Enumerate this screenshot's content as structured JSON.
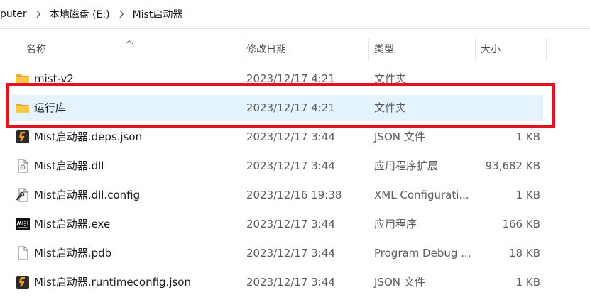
{
  "breadcrumb": [
    "puter",
    "本地磁盘 (E:)",
    "Mist启动器"
  ],
  "columns": {
    "name": "名称",
    "date": "修改日期",
    "type": "类型",
    "size": "大小"
  },
  "files": [
    {
      "name": "mist-v2",
      "date": "2023/12/17 4:21",
      "type": "文件夹",
      "size": "",
      "icon": "folder-icon"
    },
    {
      "name": "运行库",
      "date": "2023/12/17 4:21",
      "type": "文件夹",
      "size": "",
      "icon": "folder-icon",
      "selected": true
    },
    {
      "name": "Mist启动器.deps.json",
      "date": "2023/12/17 3:44",
      "type": "JSON 文件",
      "size": "1 KB",
      "icon": "json-file-icon"
    },
    {
      "name": "Mist启动器.dll",
      "date": "2023/12/17 3:44",
      "type": "应用程序扩展",
      "size": "93,682 KB",
      "icon": "dll-file-icon"
    },
    {
      "name": "Mist启动器.dll.config",
      "date": "2023/12/16 19:38",
      "type": "XML Configurati...",
      "size": "1 KB",
      "icon": "config-file-icon"
    },
    {
      "name": "Mist启动器.exe",
      "date": "2023/12/17 3:44",
      "type": "应用程序",
      "size": "166 KB",
      "icon": "exe-app-icon"
    },
    {
      "name": "Mist启动器.pdb",
      "date": "2023/12/17 3:44",
      "type": "Program Debug ...",
      "size": "18 KB",
      "icon": "pdb-file-icon"
    },
    {
      "name": "Mist启动器.runtimeconfig.json",
      "date": "2023/12/17 3:44",
      "type": "JSON 文件",
      "size": "1 KB",
      "icon": "json-file-icon"
    }
  ],
  "colors": {
    "selection": "#e5f3ff",
    "highlight_border": "#e3141f",
    "folder": "#f8c848",
    "json_icon": "#f39a1e"
  }
}
